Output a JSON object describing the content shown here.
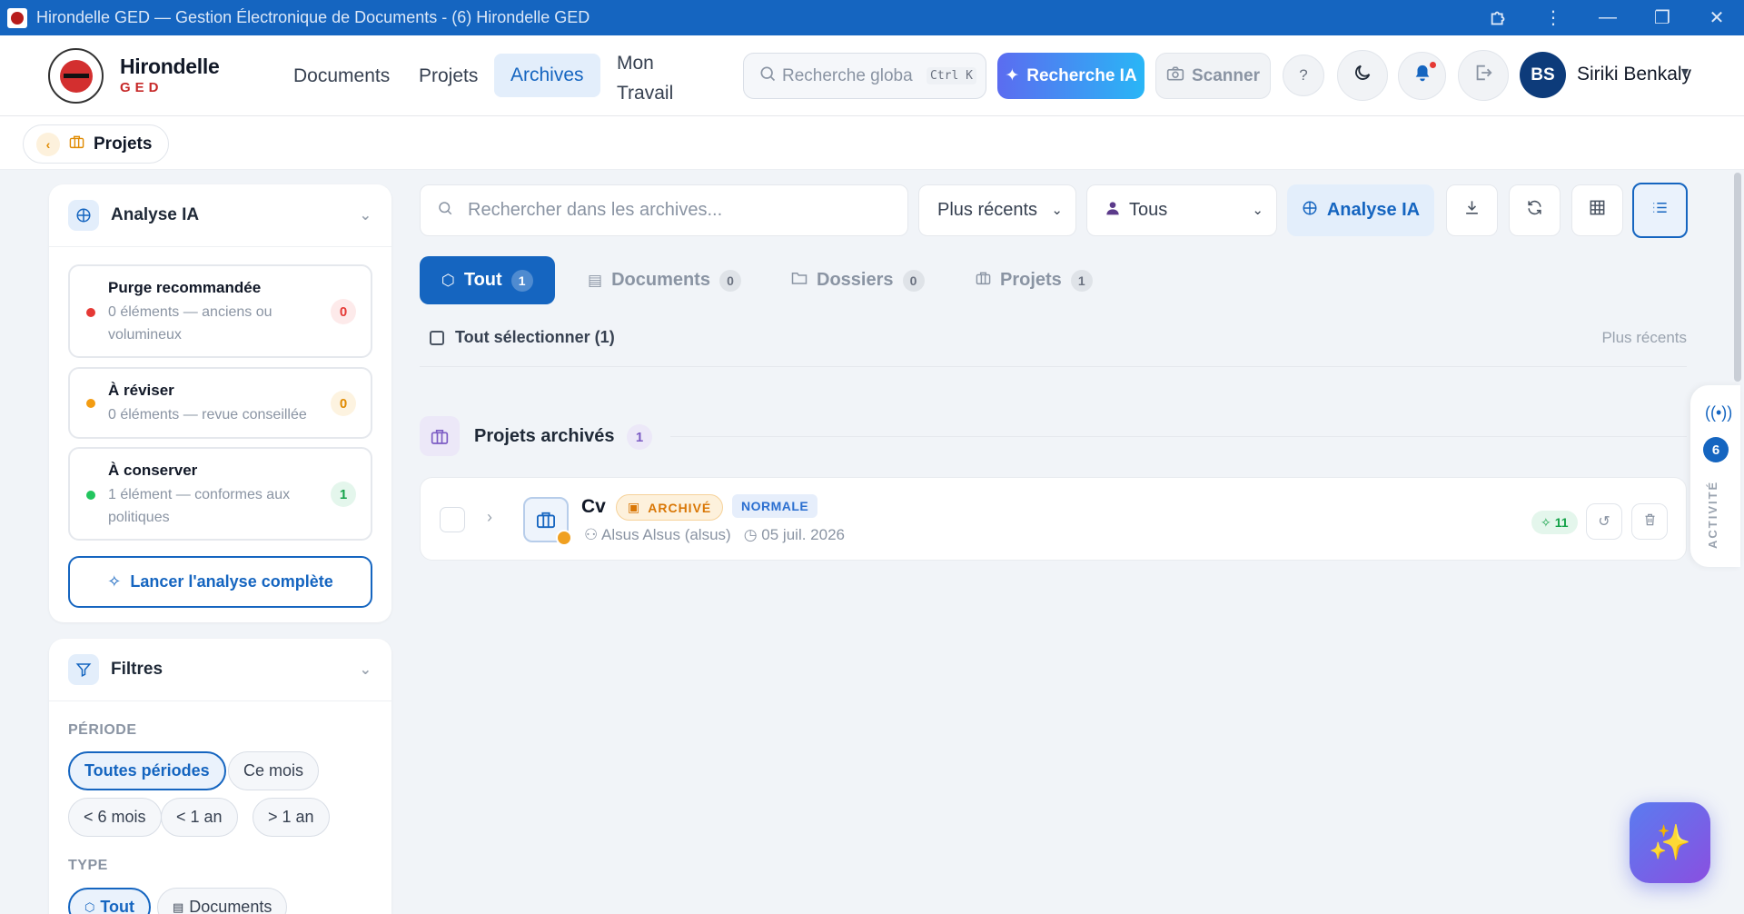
{
  "window": {
    "title": "Hirondelle GED — Gestion Électronique de Documents - (6) Hirondelle GED"
  },
  "brand": {
    "name": "Hirondelle",
    "sub": "GED"
  },
  "nav": {
    "documents": "Documents",
    "projets": "Projets",
    "archives": "Archives",
    "mon_travail_1": "Mon",
    "mon_travail_2": "Travail"
  },
  "header": {
    "search_placeholder": "Recherche globa",
    "search_shortcut": "Ctrl K",
    "ia_search": "Recherche IA",
    "scanner": "Scanner",
    "help": "?",
    "user_initials": "BS",
    "user_name": "Siriki Benkaly"
  },
  "breadcrumb": {
    "label": "Projets"
  },
  "analyse_panel": {
    "title": "Analyse IA",
    "items": [
      {
        "title": "Purge recommandée",
        "desc": "0 éléments — anciens ou volumineux",
        "count": "0",
        "color": "#e53935"
      },
      {
        "title": "À réviser",
        "desc": "0 éléments — revue conseillée",
        "count": "0",
        "color": "#f39c12"
      },
      {
        "title": "À conserver",
        "desc": "1 élément — conformes aux politiques",
        "count": "1",
        "color": "#22c55e"
      }
    ],
    "launch_button": "Lancer l'analyse complète"
  },
  "filters": {
    "title": "Filtres",
    "period_label": "PÉRIODE",
    "periods": [
      "Toutes périodes",
      "Ce mois",
      "< 6 mois",
      "< 1 an",
      "> 1 an"
    ],
    "type_label": "TYPE",
    "types": [
      "Tout",
      "Documents"
    ]
  },
  "toolbar": {
    "search_placeholder": "Rechercher dans les archives...",
    "sort_value": "Plus récents",
    "owner_value": "Tous",
    "analyse_button": "Analyse IA"
  },
  "tabs": [
    {
      "label": "Tout",
      "count": "1"
    },
    {
      "label": "Documents",
      "count": "0"
    },
    {
      "label": "Dossiers",
      "count": "0"
    },
    {
      "label": "Projets",
      "count": "1"
    }
  ],
  "selection": {
    "select_all": "Tout sélectionner (1)",
    "sort_label": "Plus récents"
  },
  "group": {
    "title": "Projets archivés",
    "count": "1"
  },
  "item": {
    "name": "Cv",
    "status": "ARCHIVÉ",
    "priority": "NORMALE",
    "owner": "Alsus Alsus (alsus)",
    "date": "05 juil. 2026",
    "score": "11"
  },
  "activity": {
    "count": "6",
    "label": "ACTIVITÉ"
  }
}
